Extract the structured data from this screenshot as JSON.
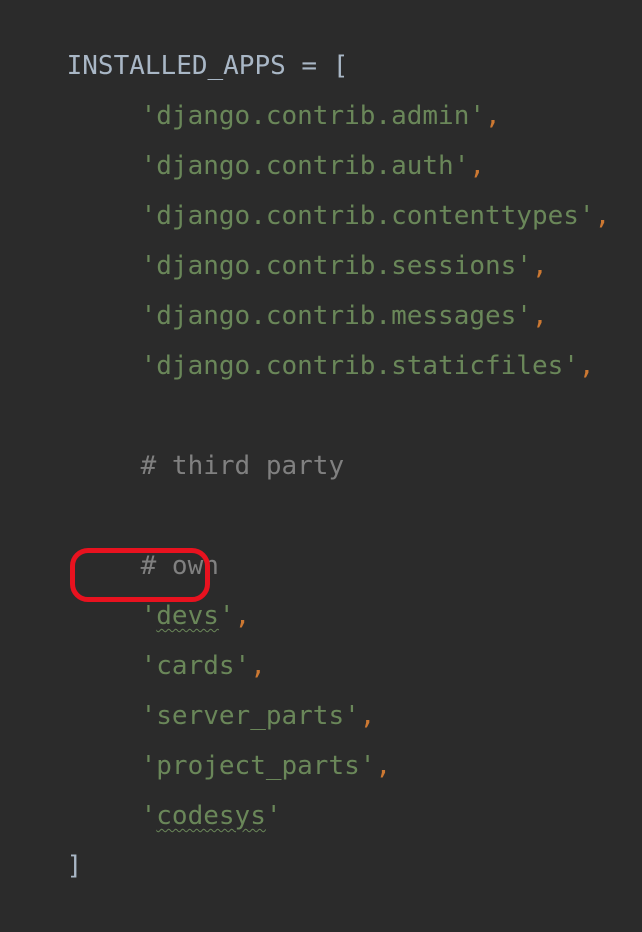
{
  "code": {
    "declaration": "INSTALLED_APPS = [",
    "closing": "]",
    "lines": [
      {
        "type": "string",
        "text": "'django.contrib.admin'",
        "comma": ","
      },
      {
        "type": "string",
        "text": "'django.contrib.auth'",
        "comma": ","
      },
      {
        "type": "string",
        "text": "'django.contrib.contenttypes'",
        "comma": ","
      },
      {
        "type": "string",
        "text": "'django.contrib.sessions'",
        "comma": ","
      },
      {
        "type": "string",
        "text": "'django.contrib.messages'",
        "comma": ","
      },
      {
        "type": "string",
        "text": "'django.contrib.staticfiles'",
        "comma": ","
      },
      {
        "type": "comment",
        "text": "# third party"
      },
      {
        "type": "comment",
        "text": "# own"
      },
      {
        "type": "string",
        "quote_open": "'",
        "name": "devs",
        "quote_close": "'",
        "comma": ",",
        "squiggle": true
      },
      {
        "type": "string",
        "text": "'cards'",
        "comma": ","
      },
      {
        "type": "string",
        "text": "'server_parts'",
        "comma": ","
      },
      {
        "type": "string",
        "text": "'project_parts'",
        "comma": ","
      },
      {
        "type": "string",
        "quote_open": "'",
        "name": "codesys",
        "quote_close": "'",
        "comma": "",
        "squiggle": true
      }
    ]
  },
  "annotation": {
    "color": "#e8121f"
  },
  "colors": {
    "background": "#2b2b2b",
    "plain": "#a9b7c6",
    "string": "#6a8759",
    "comma": "#cc7832",
    "comment": "#808080"
  }
}
